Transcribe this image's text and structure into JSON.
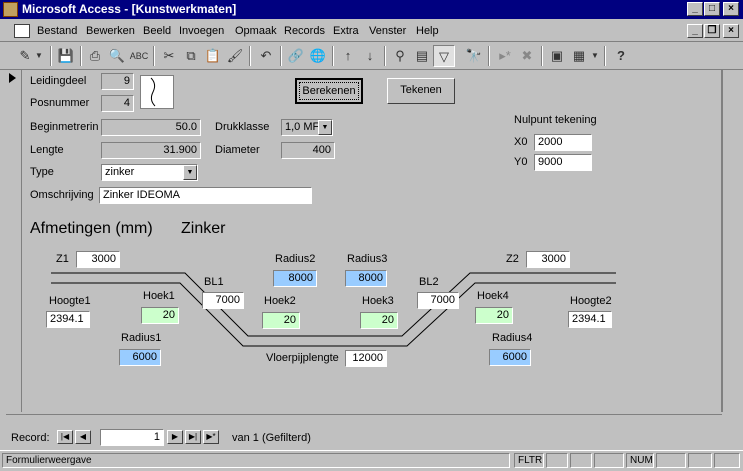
{
  "window": {
    "title": "Microsoft Access - [Kunstwerkmaten]"
  },
  "menu": {
    "items": [
      "Bestand",
      "Bewerken",
      "Beeld",
      "Invoegen",
      "Opmaak",
      "Records",
      "Extra",
      "Venster",
      "Help"
    ]
  },
  "form": {
    "leidingdeel_label": "Leidingdeel",
    "leidingdeel_value": "9",
    "posnummer_label": "Posnummer",
    "posnummer_value": "4",
    "beginmetrering_label": "Beginmetrerin",
    "beginmetrering_value": "50.0",
    "drukklasse_label": "Drukklasse",
    "drukklasse_value": "1,0 MF",
    "lengte_label": "Lengte",
    "lengte_value": "31.900",
    "diameter_label": "Diameter",
    "diameter_value": "400",
    "type_label": "Type",
    "type_value": "zinker",
    "omschrijving_label": "Omschrijving",
    "omschrijving_value": "Zinker IDEOMA",
    "berekenen_label": "Berekenen",
    "tekenen_label": "Tekenen",
    "nulpunt_label": "Nulpunt tekening",
    "x0_label": "X0",
    "x0_value": "2000",
    "y0_label": "Y0",
    "y0_value": "9000",
    "afmetingen_label": "Afmetingen (mm)",
    "zinker_label": "Zinker"
  },
  "diagram": {
    "z1_label": "Z1",
    "z1_value": "3000",
    "z2_label": "Z2",
    "z2_value": "3000",
    "radius2_label": "Radius2",
    "radius2_value": "8000",
    "radius3_label": "Radius3",
    "radius3_value": "8000",
    "bl1_label": "BL1",
    "bl1_value": "7000",
    "bl2_label": "BL2",
    "bl2_value": "7000",
    "hoogte1_label": "Hoogte1",
    "hoogte1_value": "2394.1",
    "hoogte2_label": "Hoogte2",
    "hoogte2_value": "2394.1",
    "hoek1_label": "Hoek1",
    "hoek1_value": "20",
    "hoek2_label": "Hoek2",
    "hoek2_value": "20",
    "hoek3_label": "Hoek3",
    "hoek3_value": "20",
    "hoek4_label": "Hoek4",
    "hoek4_value": "20",
    "radius1_label": "Radius1",
    "radius1_value": "6000",
    "radius4_label": "Radius4",
    "radius4_value": "6000",
    "vloerpijp_label": "Vloerpijplengte",
    "vloerpijp_value": "12000"
  },
  "nav": {
    "record_label": "Record:",
    "current": "1",
    "of_text": "van  1 (Gefilterd)"
  },
  "status": {
    "text": "Formulierweergave",
    "fltr": "FLTR",
    "num": "NUM"
  },
  "colors": {
    "titlebar": "#000080",
    "green_field": "#ccffcc",
    "blue_field": "#99ccff"
  }
}
